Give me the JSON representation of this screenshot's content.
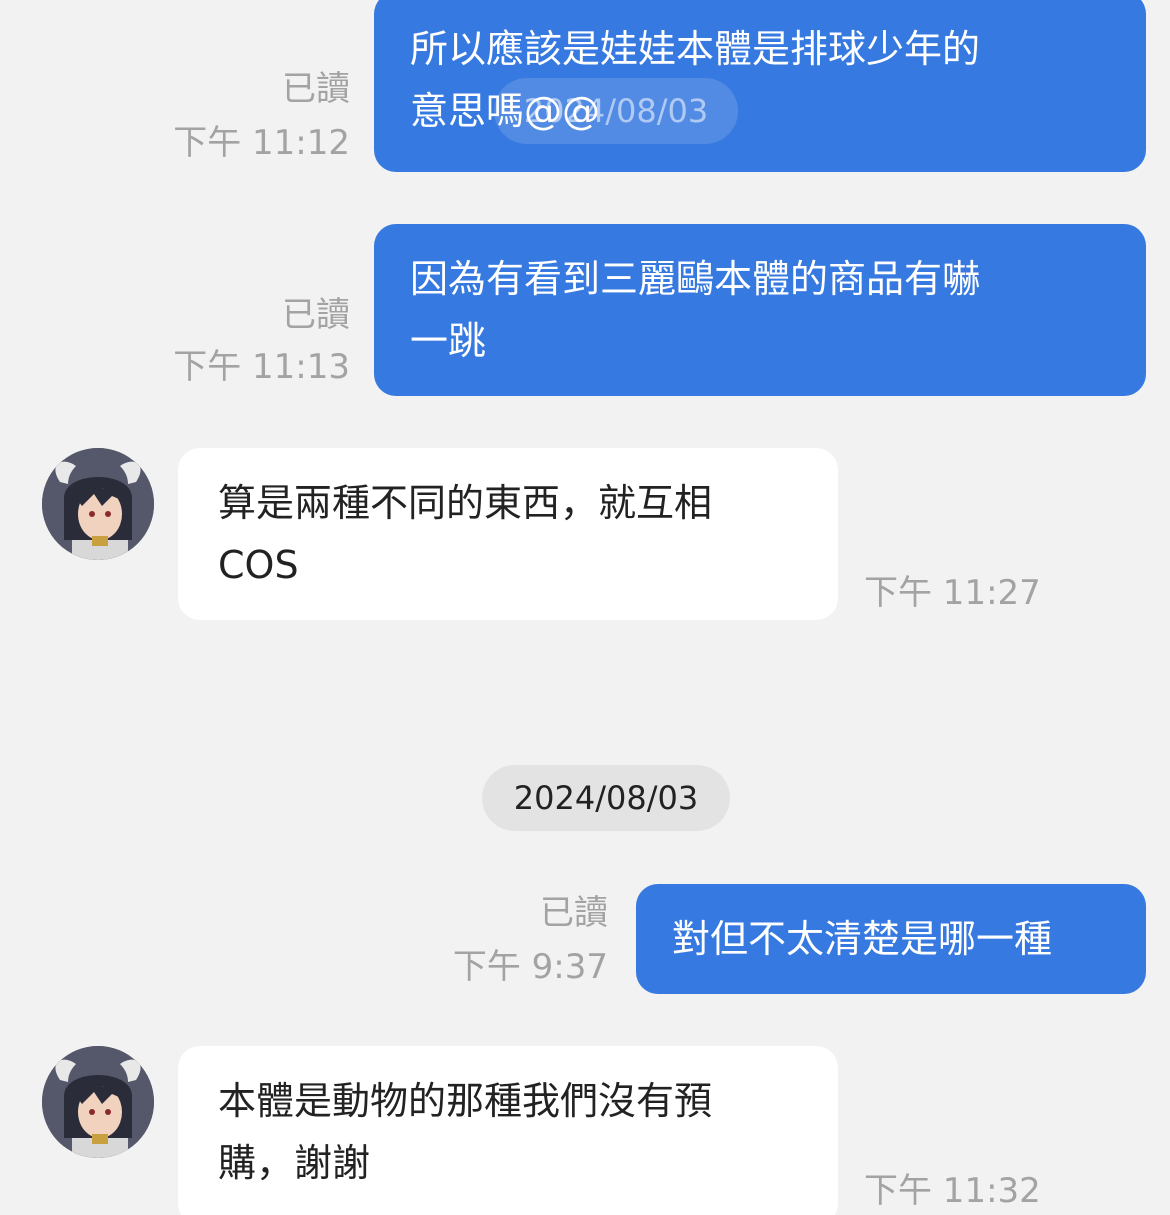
{
  "messages": [
    {
      "text": "所以應該是娃娃本體是排球少年的\n意思嗎@@",
      "read_label": "已讀",
      "time": "下午 11:12"
    },
    {
      "text": "因為有看到三麗鷗本體的商品有嚇\n一跳",
      "read_label": "已讀",
      "time": "下午 11:13"
    },
    {
      "text": "算是兩種不同的東西，就互相\nCOS",
      "time": "下午 11:27"
    },
    {
      "text": "對但不太清楚是哪一種",
      "read_label": "已讀",
      "time": "下午 9:37"
    },
    {
      "text": "本體是動物的那種我們沒有預\n購，謝謝",
      "time": "下午 11:32"
    }
  ],
  "floating_date": "2024/08/03",
  "date_separator": "2024/08/03",
  "colors": {
    "background": "#f2f2f2",
    "outgoing_bubble": "#3679e0",
    "incoming_bubble": "#ffffff",
    "meta_text": "#a3a3a3",
    "date_pill": "#e3e3e3"
  },
  "icons": {
    "contact_avatar": "anime-character-avatar"
  }
}
